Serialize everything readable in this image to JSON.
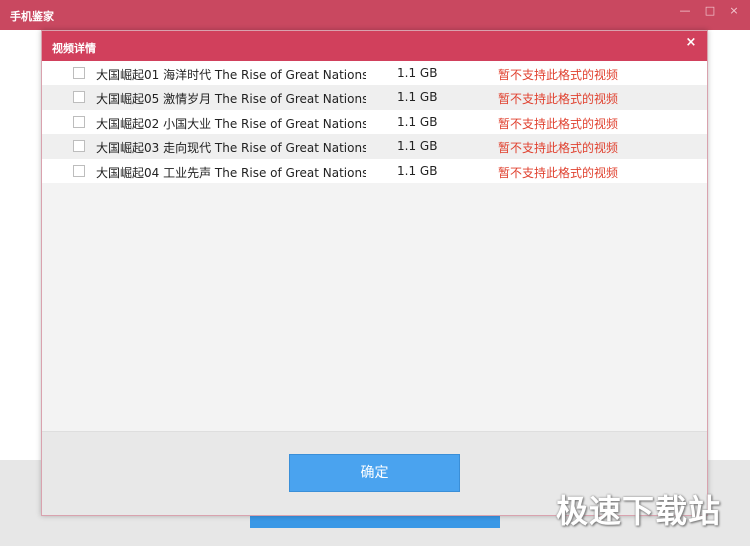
{
  "app": {
    "title": "手机鉴家",
    "controls": [
      "—",
      "□",
      "×"
    ]
  },
  "dialog": {
    "title": "视频详情",
    "close_icon": "×",
    "confirm_label": "确定",
    "files": [
      {
        "name": "大国崛起01 海洋时代 The Rise of Great Nations....",
        "size": "1.1 GB",
        "status": "暂不支持此格式的视频"
      },
      {
        "name": "大国崛起05 激情岁月 The Rise of Great Nations....",
        "size": "1.1 GB",
        "status": "暂不支持此格式的视频"
      },
      {
        "name": "大国崛起02 小国大业 The Rise of Great Nations....",
        "size": "1.1 GB",
        "status": "暂不支持此格式的视频"
      },
      {
        "name": "大国崛起03 走向现代 The Rise of Great Nations....",
        "size": "1.1 GB",
        "status": "暂不支持此格式的视频"
      },
      {
        "name": "大国崛起04 工业先声 The Rise of Great Nations....",
        "size": "1.1 GB",
        "status": "暂不支持此格式的视频"
      }
    ]
  },
  "watermark": "极速下载站",
  "colors": {
    "titlebar": "#c94860",
    "dialog_header": "#d1405c",
    "status_text": "#e0412f",
    "confirm_button": "#4aa3ef"
  }
}
